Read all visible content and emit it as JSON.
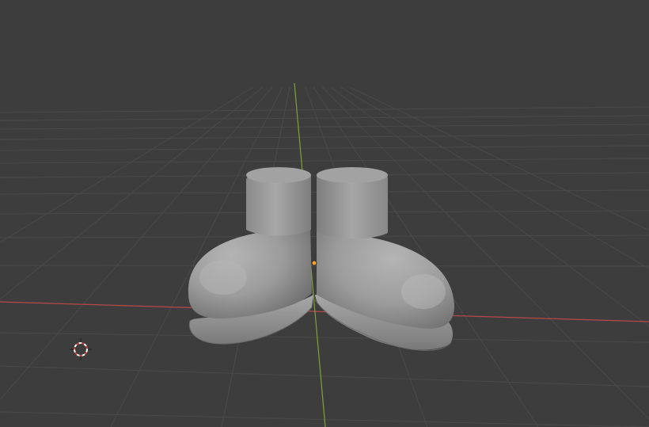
{
  "app": {
    "view": "3D Viewport"
  },
  "viewport": {
    "background_color": "#3d3d3d",
    "grid_color": "#4a4a4a",
    "x_axis_color": "#b84848",
    "y_axis_color": "#7ba23a",
    "objects": [
      {
        "type": "boot-model",
        "side": "left",
        "color": "#9a9a9a"
      },
      {
        "type": "boot-model",
        "side": "right",
        "color": "#9a9a9a"
      }
    ],
    "origin_marker_color": "#f0a030",
    "cursor_icon": "3d-cursor-icon"
  }
}
